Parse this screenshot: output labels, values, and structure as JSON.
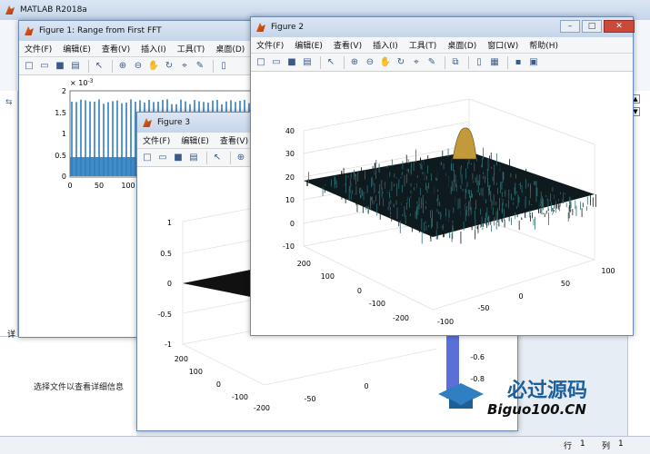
{
  "matlab": {
    "title": "MATLAB R2018a",
    "details_text": "选择文件以查看详细信息",
    "status_row": "行",
    "status_row_value": "1",
    "status_col": "列",
    "status_col_value": "1",
    "side_text": "详"
  },
  "figure1": {
    "title": "Figure 1: Range from First FFT",
    "menu": [
      "文件(F)",
      "编辑(E)",
      "查看(V)",
      "插入(I)",
      "工具(T)",
      "桌面(D)"
    ],
    "exponent": "× 10",
    "exponent_power": "-3",
    "yticks": [
      "2",
      "1.5",
      "1",
      "0.5",
      "0"
    ],
    "xticks": [
      "0",
      "50",
      "100"
    ]
  },
  "figure2": {
    "title": "Figure 2",
    "menu": [
      "文件(F)",
      "编辑(E)",
      "查看(V)",
      "插入(I)",
      "工具(T)",
      "桌面(D)",
      "窗口(W)",
      "帮助(H)"
    ],
    "zticks": [
      "40",
      "30",
      "20",
      "10",
      "0",
      "-10"
    ],
    "yticks": [
      "200",
      "100",
      "0",
      "-100",
      "-200"
    ],
    "xticks": [
      "100",
      "50",
      "0",
      "-50",
      "-100"
    ]
  },
  "figure3": {
    "title": "Figure 3",
    "menu": [
      "文件(F)",
      "编辑(E)",
      "查看(V)"
    ],
    "zticks": [
      "1",
      "0.5",
      "0",
      "-0.5",
      "-1"
    ],
    "yticks": [
      "200",
      "100",
      "0",
      "-100",
      "-200"
    ],
    "xticks": [
      "-50",
      "0"
    ],
    "colorbar_ticks": [
      "-0.6",
      "-0.8"
    ]
  },
  "watermark": {
    "text_cn": "必过源码",
    "text_en": "Biguo100.CN"
  },
  "colors": {
    "surface": "#1a2a30",
    "accent": "#2f7fc1",
    "close": "#c9493b"
  }
}
